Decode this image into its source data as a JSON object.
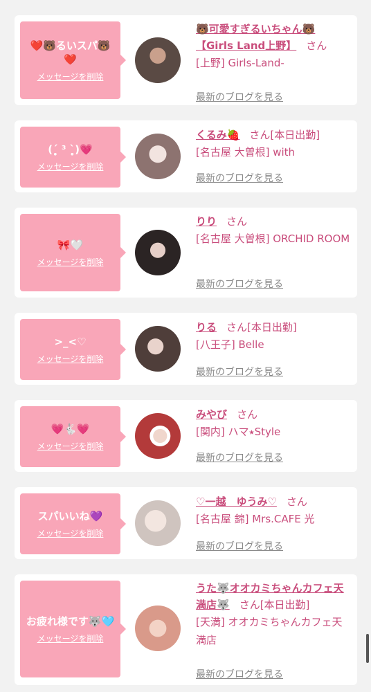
{
  "cards": [
    {
      "message": "❤️🐻るいスパ🐻❤️",
      "delete_label": "メッセージを削除",
      "name": "🐻可愛すぎるいちゃん🐻【Girls Land上野】",
      "honorific": "さん",
      "status": "",
      "shop": "[上野] Girls-Land-",
      "blog_label": "最新のブログを見る",
      "avatar_color": "#5a4a44"
    },
    {
      "message": "(ˊ̥̥̥̥̥ ³ ˋ̥̥̥̥̥)💗",
      "delete_label": "メッセージを削除",
      "name": "くるみ🍓",
      "honorific": "さん",
      "status": "[本日出勤]",
      "shop": "[名古屋 大曽根] with",
      "blog_label": "最新のブログを見る",
      "avatar_color": "#d8c7c4"
    },
    {
      "message": "🎀🤍",
      "delete_label": "メッセージを削除",
      "name": "りり",
      "honorific": "さん",
      "status": "",
      "shop": "[名古屋 大曽根] ORCHID ROOM",
      "blog_label": "最新のブログを見る",
      "avatar_color": "#3a3232"
    },
    {
      "message": ">_<♡",
      "delete_label": "メッセージを削除",
      "name": "りる",
      "honorific": "さん",
      "status": "[本日出勤]",
      "shop": "[八王子] Belle",
      "blog_label": "最新のブログを見る",
      "avatar_color": "#6b5752"
    },
    {
      "message": "💗🐇💗",
      "delete_label": "メッセージを削除",
      "name": "みやび",
      "honorific": "さん",
      "status": "",
      "shop": "[関内] ハマ⭑Style",
      "blog_label": "最新のブログを見る",
      "avatar_color": "#b33a3a"
    },
    {
      "message": "スパいいね💜",
      "delete_label": "メッセージを削除",
      "name": "♡一越　ゆうみ♡",
      "honorific": "さん",
      "status": "",
      "shop": "[名古屋 錦] Mrs.CAFE 光",
      "blog_label": "最新のブログを見る",
      "avatar_color": "#e8e2de"
    },
    {
      "message": "お疲れ様です🐺🩵",
      "delete_label": "メッセージを削除",
      "name": "うた🐺オオカミちゃんカフェ天満店🐺",
      "honorific": "さん",
      "status": "[本日出勤]",
      "shop": "[天満] オオカミちゃんカフェ天満店",
      "blog_label": "最新のブログを見る",
      "avatar_color": "#d99a8a"
    }
  ]
}
